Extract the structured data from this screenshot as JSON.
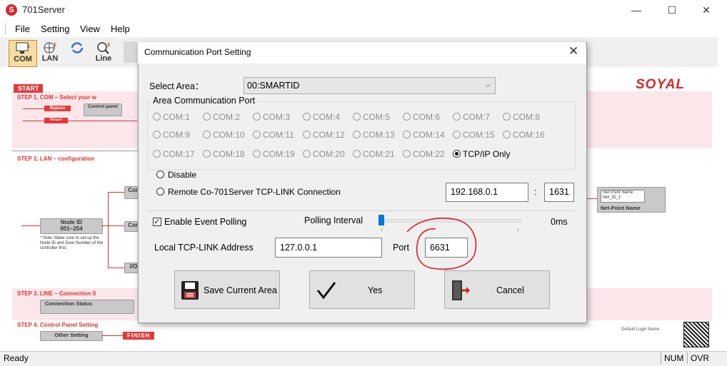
{
  "window": {
    "title": "701Server",
    "app_icon": "S",
    "minimize": "—",
    "maximize": "☐",
    "close": "✕"
  },
  "menu": [
    "File",
    "Setting",
    "View",
    "Help"
  ],
  "toolbar": {
    "buttons": [
      {
        "label": "COM",
        "num": "1"
      },
      {
        "label": "LAN",
        "num": "2"
      },
      {
        "label": "",
        "num": ""
      },
      {
        "label": "Line",
        "num": "3"
      }
    ]
  },
  "background": {
    "start": "START",
    "step1": "STEP 1. COM – Select your w",
    "bypass": "Bypass",
    "control_panel": "Control panel",
    "direct": "Direct",
    "step2": "STEP 2. LAN – configuration",
    "node_id": "Node ID",
    "node_range": "001~254",
    "note": "* Note: Make sure to set up the Node ID and Door Number of the controller first.",
    "con_label": "Con",
    "io_label": "I/O",
    "step3": "STEP 3. LINE – Connection S",
    "connection_status": "Connection Status",
    "step4": "STEP 4. Control Panel Setting",
    "other_setting": "Other Setting",
    "finish": "FINISH",
    "net_point_name_field": "Net Point Name",
    "net_point_id": "Net_ID_1",
    "net_point_name": "Net-Point Name",
    "soyal": "SOYAL",
    "default_login": "Default Login Name:"
  },
  "status": {
    "ready": "Ready",
    "num": "NUM",
    "ovr": "OVR"
  },
  "dialog": {
    "title": "Communication Port Setting",
    "select_area_label": "Select Area：",
    "select_area_value": "00:SMARTID",
    "group_title": "Area Communication Port",
    "ports": [
      "COM:1",
      "COM:2",
      "COM:3",
      "COM:4",
      "COM:5",
      "COM:6",
      "COM:7",
      "COM:8",
      "COM:9",
      "COM:10",
      "COM:11",
      "COM:12",
      "COM:13",
      "COM:14",
      "COM:15",
      "COM:16",
      "COM:17",
      "COM:18",
      "COM:19",
      "COM:20",
      "COM:21",
      "COM:22",
      "TCP/IP Only"
    ],
    "selected_port": "TCP/IP Only",
    "disable": "Disable",
    "remote": "Remote Co-701Server TCP-LINK Connection",
    "remote_ip": "192.168.0.1",
    "colon": ":",
    "remote_port": "1631",
    "enable_polling": "Enable Event Polling",
    "polling_checked": true,
    "polling_interval_label": "Polling Interval",
    "polling_interval_value": "0ms",
    "polling_level": 0,
    "local_label": "Local TCP-LINK Address",
    "local_ip": "127.0.0.1",
    "port_label": "Port",
    "local_port": "6631",
    "save_button": "Save Current Area",
    "yes_button": "Yes",
    "cancel_button": "Cancel",
    "annotation_color": "#e0192b"
  }
}
